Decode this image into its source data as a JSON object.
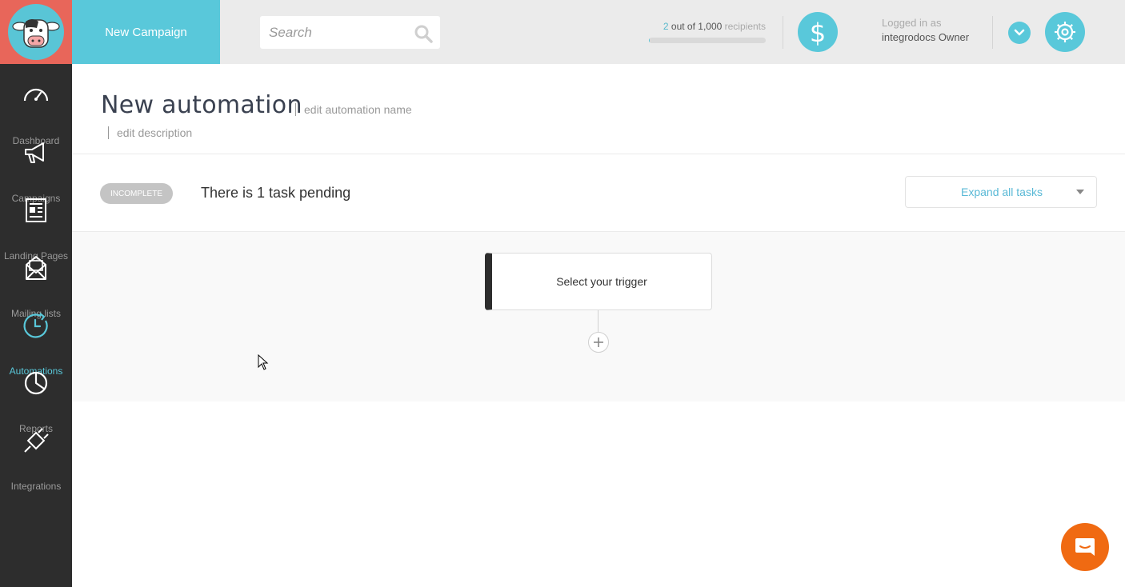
{
  "topbar": {
    "new_campaign_label": "New Campaign",
    "search_placeholder": "Search",
    "recipients": {
      "used": "2",
      "middle": " out of 1,000 ",
      "suffix": "recipients",
      "progress_fraction": 0.002
    },
    "logged_in_label": "Logged in as",
    "logged_in_user": "integrodocs Owner"
  },
  "sidebar": {
    "items": [
      {
        "label": "Dashboard",
        "icon": "speedometer-icon"
      },
      {
        "label": "Campaigns",
        "icon": "megaphone-icon"
      },
      {
        "label": "Landing Pages",
        "icon": "landing-page-icon"
      },
      {
        "label": "Mailing lists",
        "icon": "envelope-icon"
      },
      {
        "label": "Automations",
        "icon": "clock-icon",
        "active": true
      },
      {
        "label": "Reports",
        "icon": "pie-chart-icon"
      },
      {
        "label": "Integrations",
        "icon": "plug-icon"
      }
    ]
  },
  "main": {
    "title": "New automation",
    "edit_name_label": "edit automation name",
    "edit_description_label": "edit description",
    "status_badge": "INCOMPLETE",
    "pending_text": "There is 1 task pending",
    "expand_label": "Expand all tasks",
    "trigger_label": "Select your trigger"
  },
  "colors": {
    "accent": "#59c8da",
    "logo_bg": "#e8665a",
    "sidebar_bg": "#2d2d2d",
    "chat": "#f06a12"
  }
}
